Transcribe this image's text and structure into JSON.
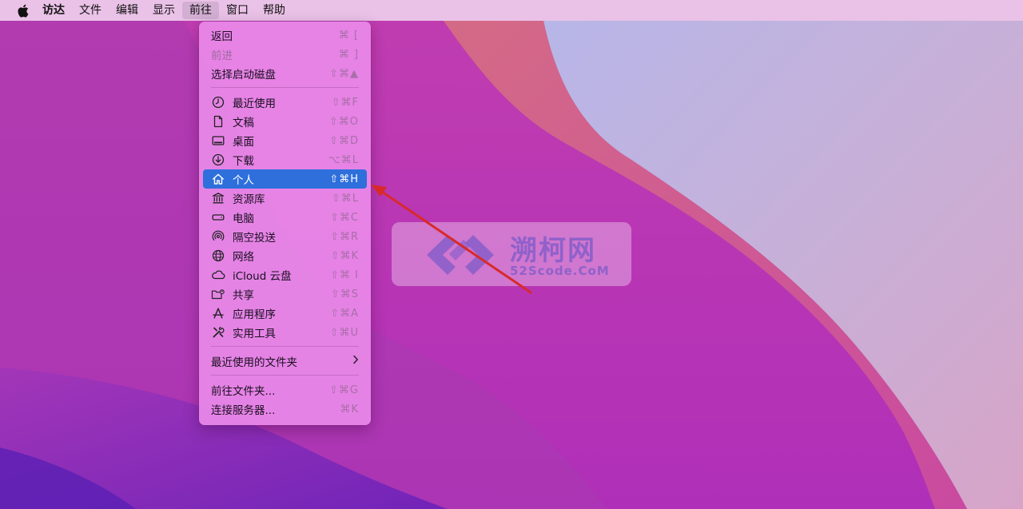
{
  "menubar": {
    "items": [
      {
        "label": "访达"
      },
      {
        "label": "文件"
      },
      {
        "label": "编辑"
      },
      {
        "label": "显示"
      },
      {
        "label": "前往"
      },
      {
        "label": "窗口"
      },
      {
        "label": "帮助"
      }
    ]
  },
  "go_menu": {
    "nav": [
      {
        "label": "返回",
        "shortcut": "⌘ ["
      },
      {
        "label": "前进",
        "shortcut": "⌘ ]"
      },
      {
        "label": "选择启动磁盘",
        "shortcut": "⇧⌘▲"
      }
    ],
    "places": [
      {
        "label": "最近使用",
        "shortcut": "⇧⌘F",
        "icon": "clock-icon"
      },
      {
        "label": "文稿",
        "shortcut": "⇧⌘O",
        "icon": "document-icon"
      },
      {
        "label": "桌面",
        "shortcut": "⇧⌘D",
        "icon": "desktop-icon"
      },
      {
        "label": "下载",
        "shortcut": "⌥⌘L",
        "icon": "download-icon"
      },
      {
        "label": "个人",
        "shortcut": "⇧⌘H",
        "icon": "home-icon"
      },
      {
        "label": "资源库",
        "shortcut": "⇧⌘L",
        "icon": "library-icon"
      },
      {
        "label": "电脑",
        "shortcut": "⇧⌘C",
        "icon": "computer-icon"
      },
      {
        "label": "隔空投送",
        "shortcut": "⇧⌘R",
        "icon": "airdrop-icon"
      },
      {
        "label": "网络",
        "shortcut": "⇧⌘K",
        "icon": "globe-icon"
      },
      {
        "label": "iCloud 云盘",
        "shortcut": "⇧⌘ I",
        "icon": "cloud-icon"
      },
      {
        "label": "共享",
        "shortcut": "⇧⌘S",
        "icon": "shared-folder-icon"
      },
      {
        "label": "应用程序",
        "shortcut": "⇧⌘A",
        "icon": "applications-icon"
      },
      {
        "label": "实用工具",
        "shortcut": "⇧⌘U",
        "icon": "utilities-icon"
      }
    ],
    "recent_folders": {
      "label": "最近使用的文件夹"
    },
    "goto": [
      {
        "label": "前往文件夹...",
        "shortcut": "⇧⌘G"
      },
      {
        "label": "连接服务器...",
        "shortcut": "⌘K"
      }
    ]
  },
  "watermark": {
    "title": "溯柯网",
    "subtitle": "52Scode.CoM"
  },
  "colors": {
    "selection": "#2e6fdc",
    "menu_bg": "#e887e8",
    "arrow": "#d82a2a"
  }
}
